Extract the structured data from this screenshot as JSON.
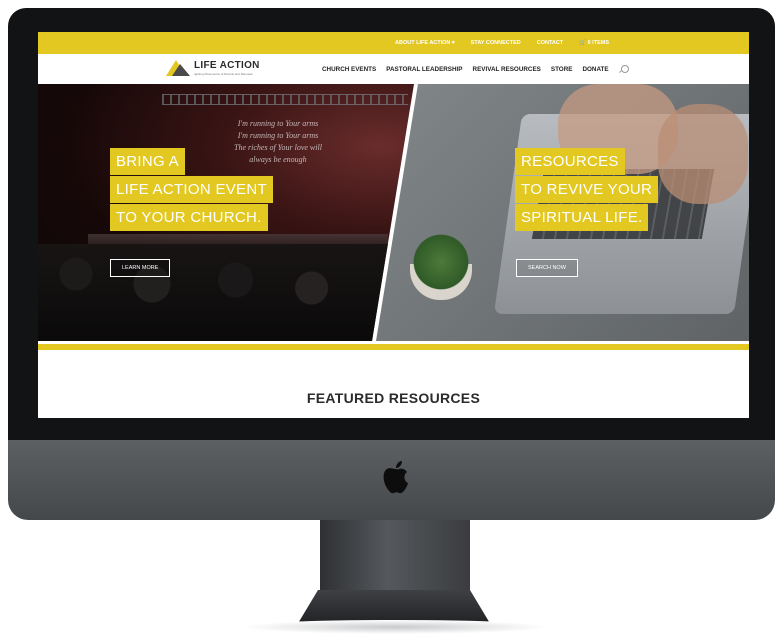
{
  "topbar": {
    "links": [
      "ABOUT LIFE ACTION ▾",
      "STAY CONNECTED",
      "CONTACT",
      "🛒 0 ITEMS"
    ]
  },
  "header": {
    "logo_text": "LIFE ACTION",
    "logo_tagline": "Igniting Movements of Revival and Renewal",
    "menu": [
      "CHURCH EVENTS",
      "PASTORAL LEADERSHIP",
      "REVIVAL RESOURCES",
      "STORE",
      "DONATE"
    ]
  },
  "hero_left": {
    "headline": [
      "BRING A",
      "LIFE ACTION EVENT",
      "TO YOUR CHURCH."
    ],
    "button": "LEARN MORE",
    "lyrics": [
      "I'm running to Your arms",
      "I'm running to Your arms",
      "The riches of Your love will",
      "always be enough"
    ]
  },
  "hero_right": {
    "headline": [
      "RESOURCES",
      "TO REVIVE YOUR",
      "SPIRITUAL LIFE."
    ],
    "button": "SEARCH NOW"
  },
  "featured": {
    "title": "FEATURED RESOURCES"
  },
  "colors": {
    "accent": "#e3c822",
    "text_dark": "#2b2b2b"
  }
}
